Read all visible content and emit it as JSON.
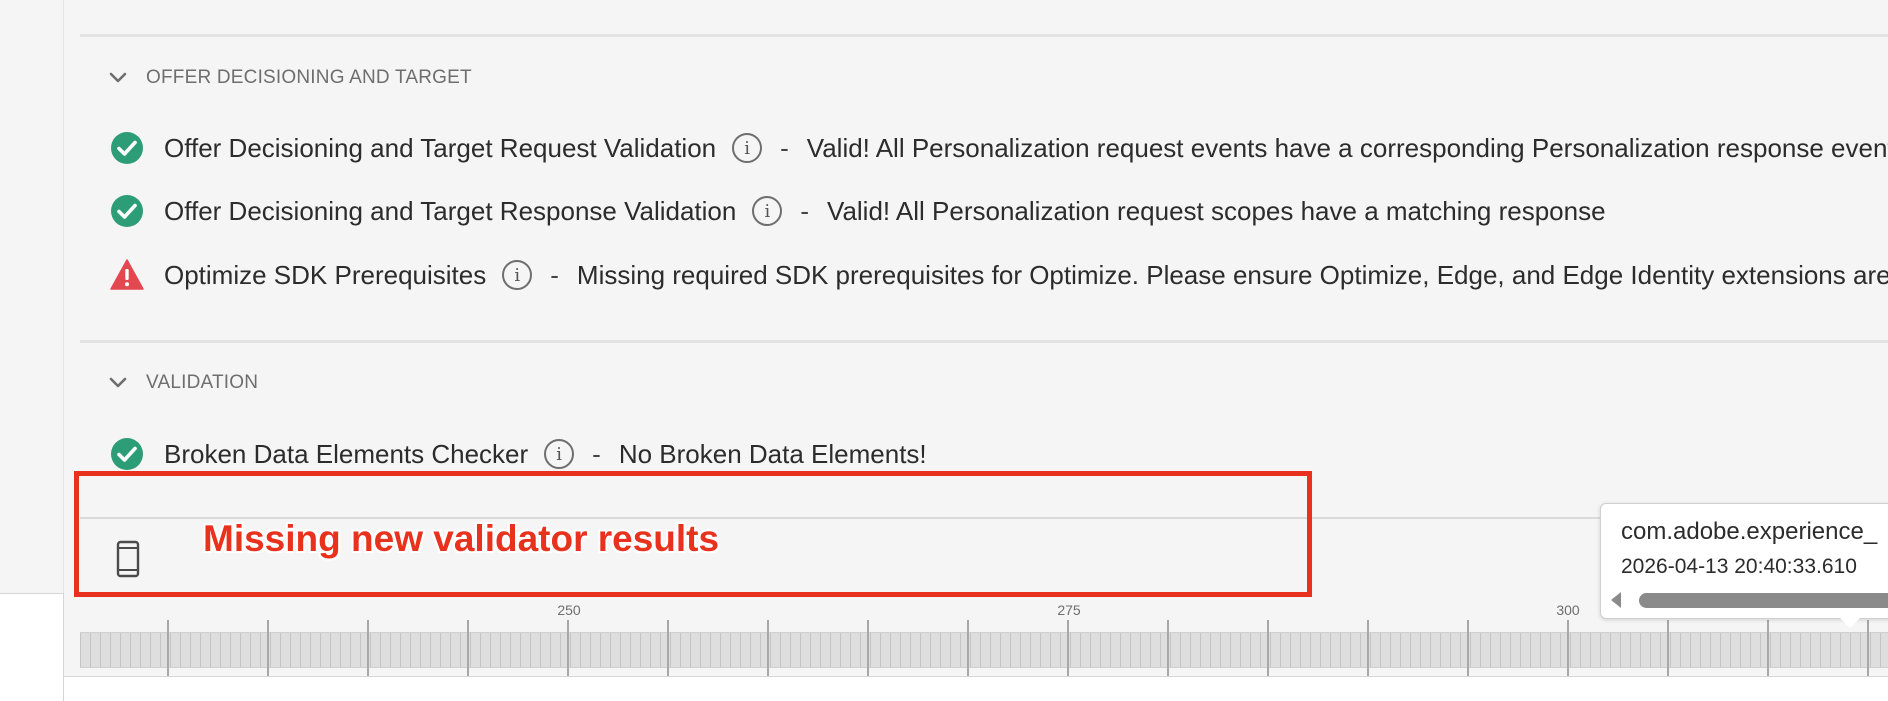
{
  "sections": [
    {
      "title": "OFFER DECISIONING AND TARGET",
      "expanded": true,
      "rows": [
        {
          "status": "valid",
          "name": "Offer Decisioning and Target Request Validation",
          "separator": "-",
          "message": "Valid! All Personalization request events have a corresponding Personalization response event a"
        },
        {
          "status": "valid",
          "name": "Offer Decisioning and Target Response Validation",
          "separator": "-",
          "message": "Valid! All Personalization request scopes have a matching response"
        },
        {
          "status": "warning",
          "name": "Optimize SDK Prerequisites",
          "separator": "-",
          "message": "Missing required SDK prerequisites for Optimize. Please ensure Optimize, Edge, and Edge Identity extensions are inst"
        }
      ]
    },
    {
      "title": "VALIDATION",
      "expanded": true,
      "rows": [
        {
          "status": "valid",
          "name": "Broken Data Elements Checker",
          "separator": "-",
          "message": "No Broken Data Elements!"
        }
      ]
    }
  ],
  "info_glyph": "i",
  "icons": {
    "chevron": "chevron-down-icon",
    "valid": "check-circle-icon",
    "warning": "alert-triangle-icon",
    "info": "info-icon",
    "device": "mobile-device-icon"
  },
  "colors": {
    "valid": "#2d9d78",
    "warning": "#e34850",
    "annotation": "#e8321d"
  },
  "annotation": {
    "text": "Missing new validator results"
  },
  "tooltip": {
    "title": "com.adobe.experience_",
    "timestamp": "2026-04-13 20:40:33.610"
  },
  "timeline": {
    "labels": [
      "250",
      "275",
      "300"
    ]
  }
}
